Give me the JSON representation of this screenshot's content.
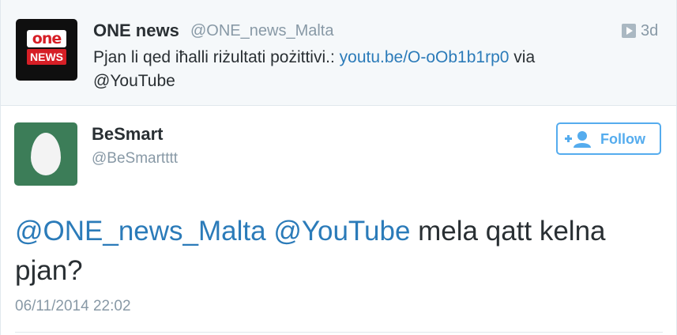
{
  "parent_tweet": {
    "avatar_top_text": "one",
    "avatar_bottom_text": "NEWS",
    "name": "ONE news",
    "handle": "@ONE_news_Malta",
    "time": "3d",
    "text_before_link": "Pjan li qed iħalli riżultati pożittivi.: ",
    "link": "youtu.be/O-oOb1b1rp0",
    "text_after_link": " via",
    "mention_line": "@YouTube"
  },
  "tweet": {
    "author_name": "BeSmart",
    "author_handle": "@BeSmartttt",
    "follow_label": "Follow",
    "mention_1": "@ONE_news_Malta",
    "mention_2": "@YouTube",
    "body": " mela qatt kelna pjan?",
    "timestamp": "06/11/2014 22:02"
  },
  "icons": {
    "parent_avatar": "one-news-logo",
    "time_icon": "media-play-icon",
    "author_avatar": "egg-avatar",
    "follow_icon": "add-user-icon"
  },
  "colors": {
    "link": "#2b7bb9",
    "follow_accent": "#55acee",
    "secondary_text": "#8899a6",
    "primary_text": "#292f33",
    "parent_background": "#f5f8fa"
  }
}
